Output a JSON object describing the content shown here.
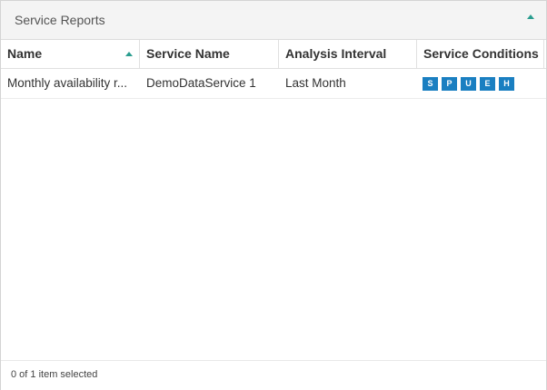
{
  "panel": {
    "title": "Service Reports"
  },
  "grid": {
    "columns": [
      {
        "label": "Name",
        "sorted": "ascending"
      },
      {
        "label": "Service Name"
      },
      {
        "label": "Analysis Interval"
      },
      {
        "label": "Service Conditions"
      }
    ],
    "rows": [
      {
        "name": "Monthly availability r...",
        "service_name": "DemoDataService 1",
        "analysis_interval": "Last Month",
        "conditions": [
          "S",
          "P",
          "U",
          "E",
          "H"
        ]
      }
    ]
  },
  "footer": {
    "selection_status": "0 of 1 item selected"
  },
  "colors": {
    "accent": "#2a9d8f",
    "badge": "#1a7fc1"
  },
  "icons": {
    "collapse": "chevron-up-icon",
    "sort": "sort-ascending-icon"
  }
}
